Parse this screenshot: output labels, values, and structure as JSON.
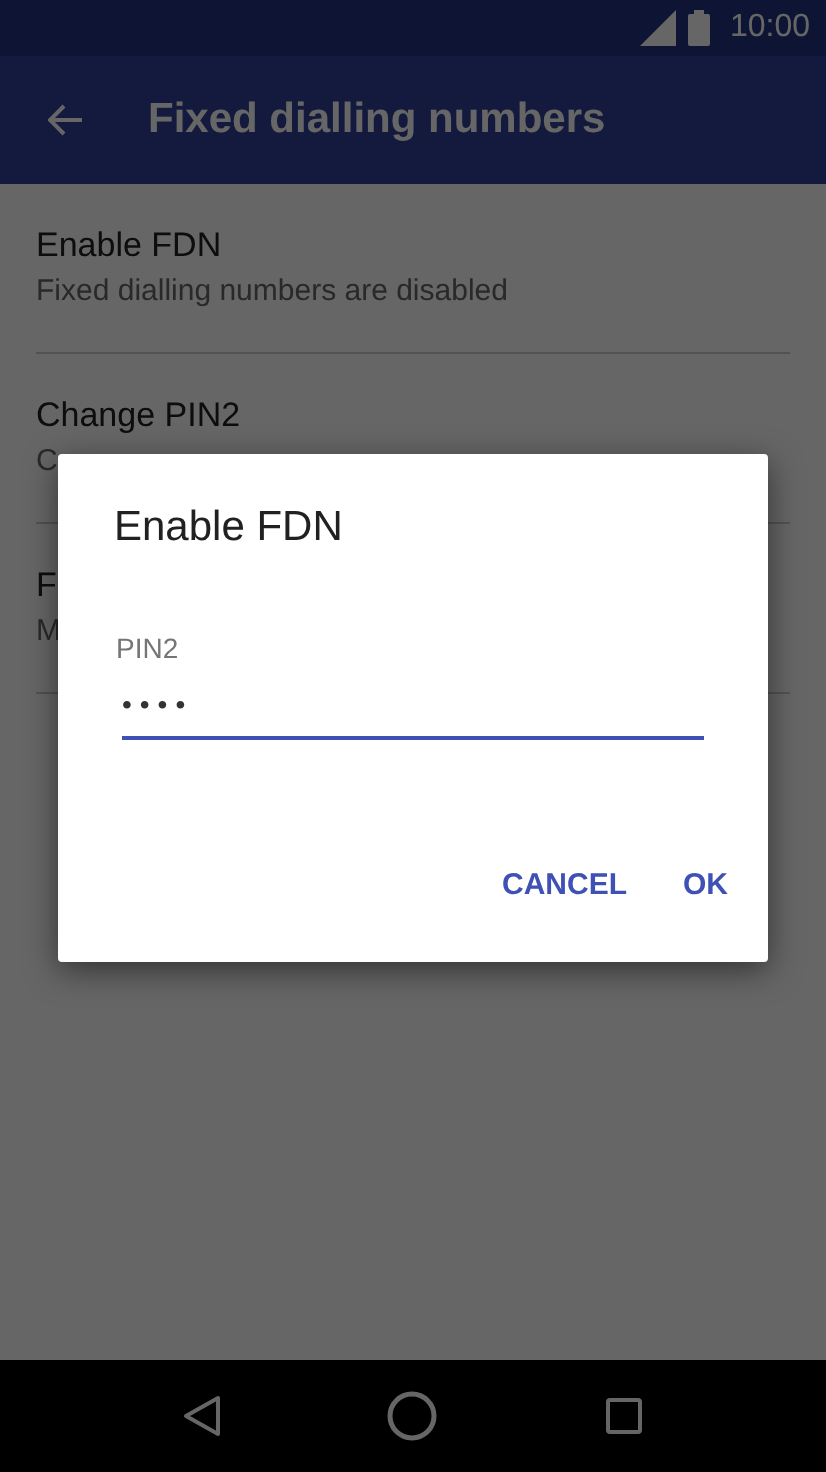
{
  "status_bar": {
    "time": "10:00"
  },
  "app_bar": {
    "title": "Fixed dialling numbers"
  },
  "list": [
    {
      "title": "Enable FDN",
      "subtitle": "Fixed dialling numbers are disabled"
    },
    {
      "title": "Change PIN2",
      "subtitle": "C"
    },
    {
      "title": "F",
      "subtitle": "M"
    }
  ],
  "dialog": {
    "title": "Enable FDN",
    "field": {
      "label": "PIN2",
      "value": "••••",
      "focused": true
    },
    "buttons": [
      "CANCEL",
      "OK"
    ]
  }
}
